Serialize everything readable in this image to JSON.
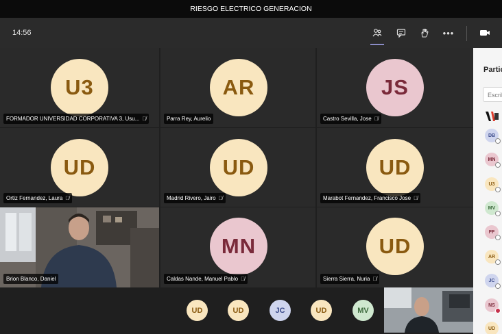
{
  "meeting": {
    "title": "RIESGO ELECTRICO GENERACION",
    "time": "14:56"
  },
  "toolbar": {
    "buttons": [
      {
        "name": "participants-button",
        "icon": "people-icon",
        "glyph": "⚇"
      },
      {
        "name": "chat-button",
        "icon": "chat-icon",
        "glyph": "▭"
      },
      {
        "name": "raise-hand-button",
        "icon": "hand-icon",
        "glyph": "✋"
      },
      {
        "name": "more-actions-button",
        "icon": "more-icon",
        "glyph": "•••"
      },
      {
        "name": "camera-button",
        "icon": "camera-icon",
        "glyph": "■"
      }
    ]
  },
  "tiles": [
    {
      "initials": "U3",
      "name": "FORMADOR UNIVERSIDAD CORPORATIVA 3, Usu...",
      "color": "cream"
    },
    {
      "initials": "AR",
      "name": "Parra Rey, Aurelio",
      "color": "cream",
      "muted": false
    },
    {
      "initials": "JS",
      "name": "Castro Sevilla, Jose",
      "color": "pink"
    },
    {
      "initials": "UD",
      "name": "Ortiz Fernandez, Laura",
      "color": "cream"
    },
    {
      "initials": "UD",
      "name": "Madrid Rivero, Jairo",
      "color": "cream"
    },
    {
      "initials": "UD",
      "name": "Marabot Fernandez, Francisco Jose",
      "color": "cream"
    },
    {
      "initials": "",
      "name": "Brion Blanco, Daniel",
      "video": true
    },
    {
      "initials": "MN",
      "name": "Caldas Nande, Manuel Pablo",
      "color": "pink"
    },
    {
      "initials": "UD",
      "name": "Sierra Sierra, Nuria",
      "color": "cream"
    }
  ],
  "overflow": [
    {
      "initials": "UD",
      "color": "cream"
    },
    {
      "initials": "UD",
      "color": "cream"
    },
    {
      "initials": "JC",
      "color": "blue"
    },
    {
      "initials": "UD",
      "color": "cream"
    },
    {
      "initials": "MV",
      "color": "green"
    }
  ],
  "panel": {
    "title": "Participantes",
    "search_placeholder": "Escribir un nombre",
    "people": [
      {
        "initials": "",
        "logo": true
      },
      {
        "initials": "DB",
        "bg": "#cfd5ee",
        "fg": "#3a4a8a"
      },
      {
        "initials": "MN",
        "bg": "#eac7cf",
        "fg": "#7a2a3a"
      },
      {
        "initials": "U3",
        "bg": "#f9e6bf",
        "fg": "#8a5a10"
      },
      {
        "initials": "MV",
        "bg": "#cfe8cf",
        "fg": "#3c6a3c"
      },
      {
        "initials": "FF",
        "bg": "#eac7cf",
        "fg": "#7a2a3a"
      },
      {
        "initials": "AR",
        "bg": "#f9e6bf",
        "fg": "#8a5a10"
      },
      {
        "initials": "JC",
        "bg": "#cfd5ee",
        "fg": "#3a4a8a"
      },
      {
        "initials": "NS",
        "bg": "#eac7cf",
        "fg": "#7a2a3a"
      },
      {
        "initials": "UD",
        "bg": "#f9e6bf",
        "fg": "#8a5a10"
      }
    ]
  }
}
